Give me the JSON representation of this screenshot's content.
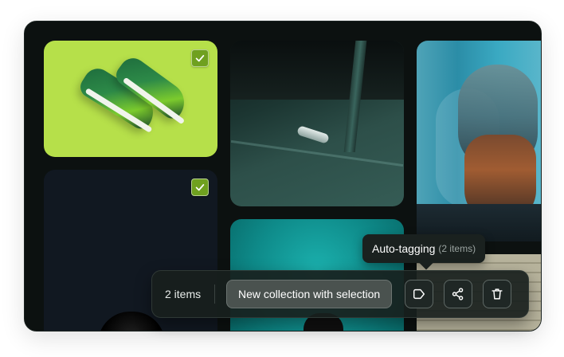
{
  "gallery": {
    "tiles": [
      {
        "name": "sneakers",
        "selected": true
      },
      {
        "name": "car-door",
        "selected": false
      },
      {
        "name": "bearded-man-portrait",
        "selected": false
      },
      {
        "name": "dark-portrait",
        "selected": true
      },
      {
        "name": "teal-portrait",
        "selected": false
      },
      {
        "name": "brick-scene",
        "selected": false
      }
    ]
  },
  "tooltip": {
    "label": "Auto-tagging",
    "sub": "(2 items)"
  },
  "action_bar": {
    "count_label": "2 items",
    "new_collection_label": "New collection with selection",
    "icons": [
      "tag-icon",
      "share-icon",
      "trash-icon"
    ]
  },
  "colors": {
    "background": "#0c1110",
    "check": "#6fa01f",
    "bar": "#181f1d",
    "primary_button": "#4a524f"
  }
}
